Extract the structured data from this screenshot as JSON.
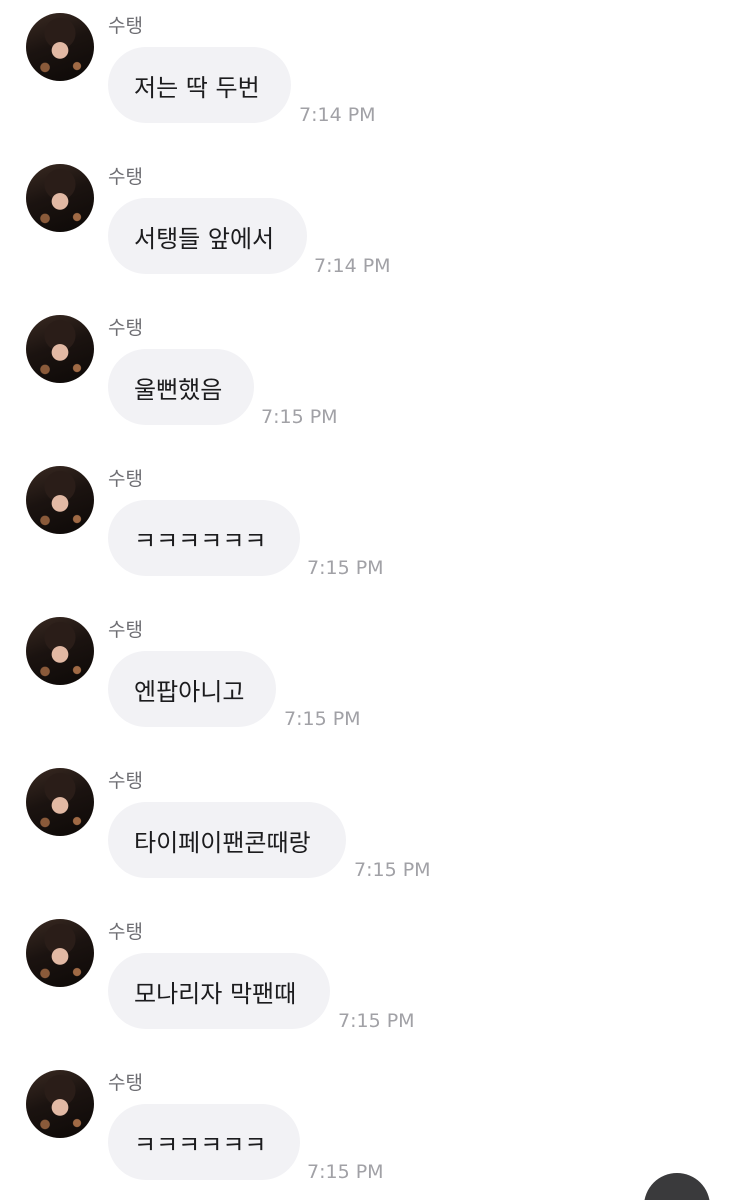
{
  "messages": [
    {
      "sender": "수탱",
      "text": "저는 딱 두번",
      "time": "7:14 PM"
    },
    {
      "sender": "수탱",
      "text": "서탱들 앞에서",
      "time": "7:14 PM"
    },
    {
      "sender": "수탱",
      "text": "울뻔했음",
      "time": "7:15 PM"
    },
    {
      "sender": "수탱",
      "text": "ㅋㅋㅋㅋㅋㅋ",
      "time": "7:15 PM"
    },
    {
      "sender": "수탱",
      "text": "엔팝아니고",
      "time": "7:15 PM"
    },
    {
      "sender": "수탱",
      "text": "타이페이팬콘때랑",
      "time": "7:15 PM"
    },
    {
      "sender": "수탱",
      "text": "모나리자 막팬때",
      "time": "7:15 PM"
    },
    {
      "sender": "수탱",
      "text": "ㅋㅋㅋㅋㅋㅋ",
      "time": "7:15 PM"
    }
  ],
  "icons": {
    "avatar": "profile-photo",
    "fab": "scroll-down-button"
  }
}
